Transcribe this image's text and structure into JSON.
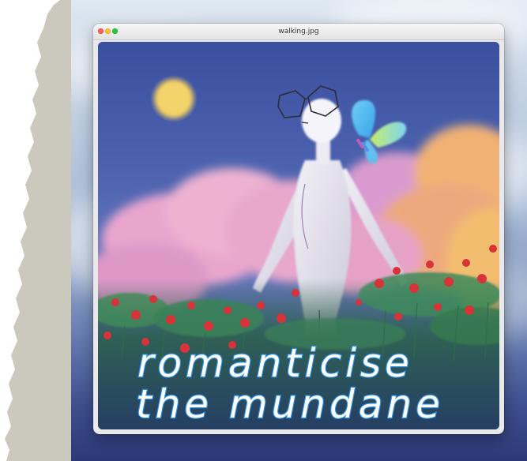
{
  "window": {
    "title": "walking.jpg"
  },
  "artwork": {
    "caption_line1": "romanticise",
    "caption_line2": "the mundane"
  },
  "colors": {
    "sky_top": "#3f53a2",
    "sun": "#f4d56b",
    "cloud_pink": "#e7a6c8",
    "cloud_orange": "#f2b170",
    "figure": "#e4e2ea",
    "butterfly_blue": "#4fb8ef",
    "butterfly_green": "#b7e86a",
    "flower_red": "#d8323a",
    "leaf_green": "#3c8a5a",
    "text_outline": "#2c8fe6",
    "text_fill": "#ffffff"
  }
}
